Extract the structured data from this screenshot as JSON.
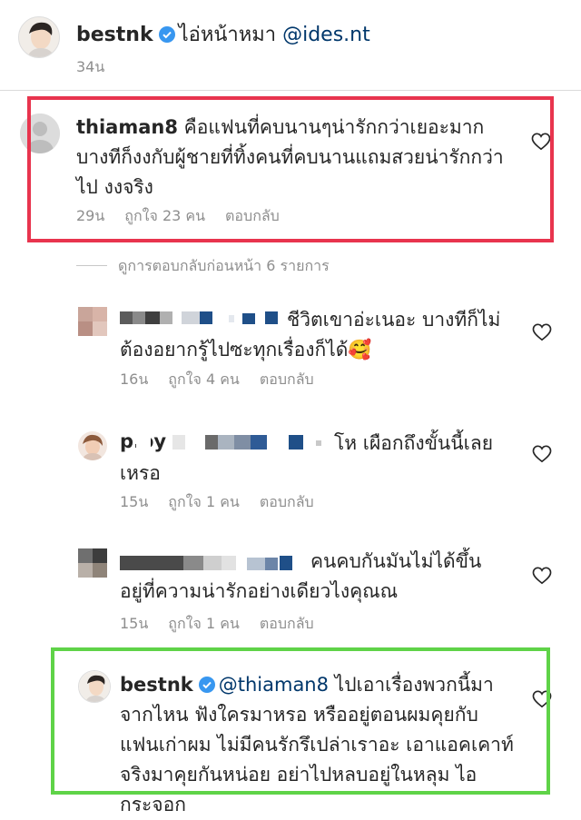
{
  "post": {
    "username": "bestnk",
    "caption": "ไอ่หน้าหมา",
    "mention": "@ides.nt",
    "time": "34น"
  },
  "comment1": {
    "username": "thiaman8",
    "line1": "คือแฟนที่คบนานๆน่ารักกว่าเยอะมาก",
    "line2": "บางทีก็งงกับผู้ชายที่ทิ้งคนที่คบนานแถมสวยน่ารักกว่า",
    "line3": "ไป งงจริง",
    "time": "29น",
    "likes": "ถูกใจ 23 คน",
    "reply": "ตอบกลับ"
  },
  "view_replies": "ดูการตอบกลับก่อนหน้า 6 รายการ",
  "reply1": {
    "line1": "ชีวิตเขาอ่ะเนอะ บางทีก็ไม่",
    "line2": "ต้องอยากรู้ไปซะทุกเรื่องก็ได้🥰",
    "time": "16น",
    "likes": "ถูกใจ 4 คน",
    "reply": "ตอบกลับ"
  },
  "reply2": {
    "username_partial": "p.oy",
    "line1": "โห เผือกถึงขั้นนี้เลย",
    "line2": "เหรอ",
    "time": "15น",
    "likes": "ถูกใจ 1 คน",
    "reply": "ตอบกลับ"
  },
  "reply3": {
    "line1": "คนคบกันมันไม่ได้ขึ้น",
    "line2": "อยู่ที่ความน่ารักอย่างเดียวไงคุณณ",
    "time": "15น",
    "likes": "ถูกใจ 1 คน",
    "reply": "ตอบกลับ"
  },
  "reply4": {
    "username": "bestnk",
    "mention": "@thiaman8",
    "line1": "ไปเอาเรื่องพวกนี้มา",
    "line2": "จากไหน ฟังใครมาหรอ หรืออยู่ตอนผมคุยกับ",
    "line3": "แฟนเก่าผม ไม่มีคนรักรึเปล่าเราอะ เอาแอคเคาท์",
    "line4": "จริงมาคุยกันหน่อย อย่าไปหลบอยู่ในหลุม ไอ",
    "line5": "กระจอก"
  },
  "colors": {
    "highlight_red": "#e8344e",
    "highlight_green": "#5fd348",
    "verified_blue": "#3897f0",
    "mention_blue": "#00376b",
    "meta_gray": "#8e8e8e"
  },
  "icons": [
    "verified-badge-icon",
    "heart-icon"
  ]
}
